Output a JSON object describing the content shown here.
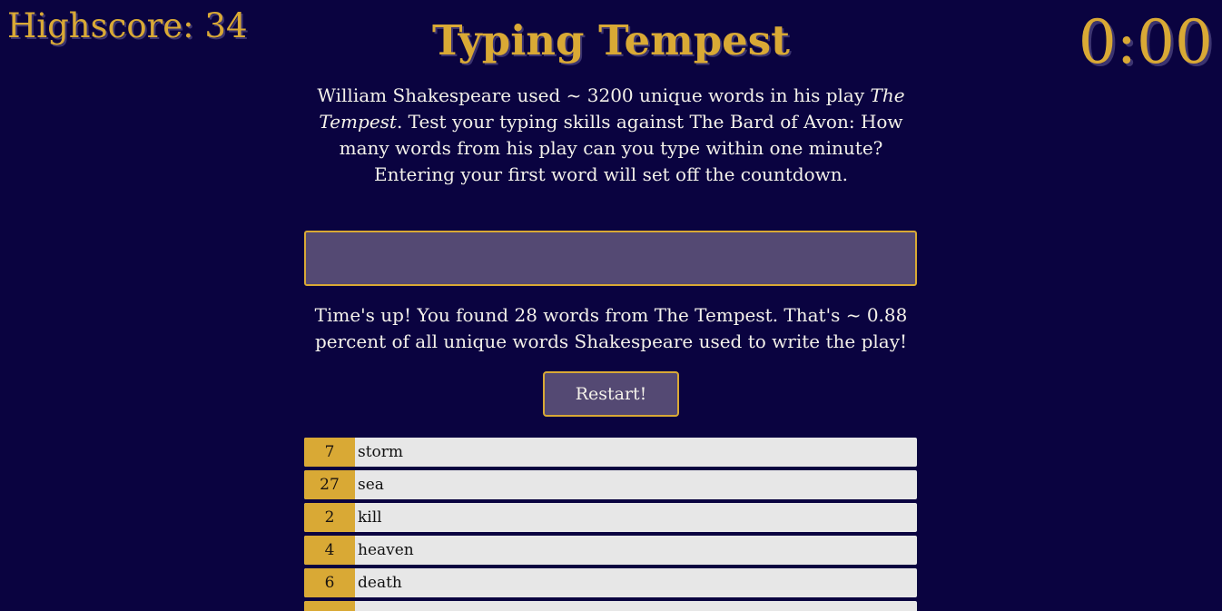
{
  "header": {
    "highscore": "Highscore: 34",
    "title": "Typing Tempest",
    "timer": "0:00"
  },
  "intro": {
    "before_play": "William Shakespeare used ~ 3200 unique words in his play ",
    "play_title": "The Tempest",
    "after_play": ". Test your typing skills against The Bard of Avon: How many words from his play can you type within one minute? Entering your first word will set off the countdown."
  },
  "input": {
    "value": "",
    "placeholder": ""
  },
  "result": {
    "message": "Time's up! You found 28 words from The Tempest. That's ~ 0.88 percent of all unique words Shakespeare used to write the play!"
  },
  "restart_label": "Restart!",
  "words": [
    {
      "count": "7",
      "word": "storm"
    },
    {
      "count": "27",
      "word": "sea"
    },
    {
      "count": "2",
      "word": "kill"
    },
    {
      "count": "4",
      "word": "heaven"
    },
    {
      "count": "6",
      "word": "death"
    }
  ],
  "colors": {
    "background": "#0a0340",
    "accent": "#d9a935",
    "panel": "#544973",
    "row": "#e7e7e7"
  }
}
